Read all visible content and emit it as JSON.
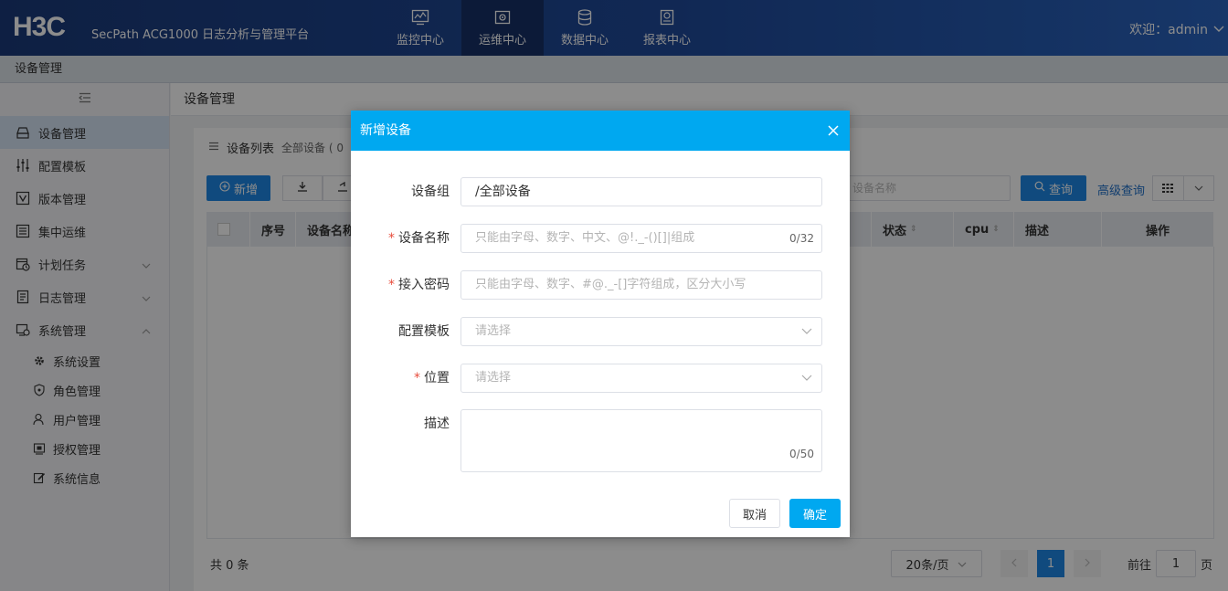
{
  "header": {
    "logo": "H3C",
    "product": "SecPath ACG1000 日志分析与管理平台",
    "nav": [
      {
        "label": "监控中心",
        "icon": "monitor-icon"
      },
      {
        "label": "运维中心",
        "icon": "maintenance-icon",
        "active": true
      },
      {
        "label": "数据中心",
        "icon": "database-icon"
      },
      {
        "label": "报表中心",
        "icon": "report-icon"
      }
    ],
    "welcome": "欢迎：admin"
  },
  "breadcrumb": "设备管理",
  "sidebar": {
    "items": [
      {
        "label": "设备管理",
        "icon": "device-icon",
        "active": true
      },
      {
        "label": "配置模板",
        "icon": "sliders-icon"
      },
      {
        "label": "版本管理",
        "icon": "version-icon"
      },
      {
        "label": "集中运维",
        "icon": "central-ops-icon"
      },
      {
        "label": "计划任务",
        "icon": "schedule-icon"
      },
      {
        "label": "日志管理",
        "icon": "log-icon"
      },
      {
        "label": "系统管理",
        "icon": "system-icon"
      }
    ],
    "subitems": [
      {
        "label": "系统设置",
        "icon": "gear-icon"
      },
      {
        "label": "角色管理",
        "icon": "shield-icon"
      },
      {
        "label": "用户管理",
        "icon": "user-icon"
      },
      {
        "label": "授权管理",
        "icon": "license-icon"
      },
      {
        "label": "系统信息",
        "icon": "edit-icon"
      }
    ]
  },
  "content": {
    "title": "设备管理",
    "list_title": "设备列表",
    "list_sub": "全部设备 ( 0",
    "add_label": "新增",
    "search_placeholder": "设备名称",
    "query_label": "查询",
    "advanced_query": "高级查询",
    "columns": [
      "序号",
      "设备名称",
      "状态",
      "cpu",
      "描述",
      "操作"
    ],
    "total": "共 0 条",
    "page_size": "20条/页",
    "current_page": "1",
    "goto_label": "前往",
    "goto_value": "1",
    "page_suffix": "页"
  },
  "dialog": {
    "title": "新增设备",
    "fields": {
      "group": {
        "label": "设备组",
        "value": "/全部设备"
      },
      "name": {
        "label": "设备名称",
        "placeholder": "只能由字母、数字、中文、@!._-()[]|组成",
        "count": "0/32"
      },
      "password": {
        "label": "接入密码",
        "placeholder": "只能由字母、数字、#@._-[]字符组成，区分大小写"
      },
      "template": {
        "label": "配置模板",
        "placeholder": "请选择"
      },
      "location": {
        "label": "位置",
        "placeholder": "请选择"
      },
      "desc": {
        "label": "描述",
        "count": "0/50"
      }
    },
    "cancel": "取消",
    "ok": "确定"
  }
}
